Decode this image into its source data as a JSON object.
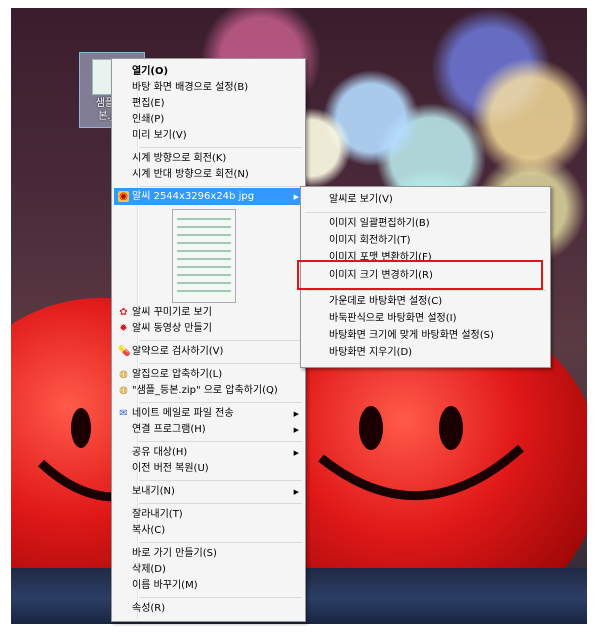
{
  "desktop": {
    "icon_label": "샘플_등본.jpg"
  },
  "context_menu": {
    "items": [
      {
        "label": "열기(O)",
        "bold": true
      },
      {
        "label": "바탕 화면 배경으로 설정(B)"
      },
      {
        "label": "편집(E)"
      },
      {
        "label": "인쇄(P)"
      },
      {
        "label": "미리 보기(V)"
      },
      {
        "label": "시계 방향으로 회전(K)"
      },
      {
        "label": "시계 반대 방향으로 회전(N)"
      },
      {
        "label": "알씨 2544x3296x24b jpg",
        "highlighted": true,
        "submenu": true
      },
      {
        "label": "알씨 꾸미기로 보기"
      },
      {
        "label": "알씨 동영상 만들기"
      },
      {
        "label": "알약으로 검사하기(V)"
      },
      {
        "label": "알집으로 압축하기(L)"
      },
      {
        "label": "\"샘플_등본.zip\" 으로 압축하기(Q)"
      },
      {
        "label": "네이트 메일로 파일 전송",
        "submenu": true
      },
      {
        "label": "연결 프로그램(H)",
        "submenu": true
      },
      {
        "label": "공유 대상(H)",
        "submenu": true
      },
      {
        "label": "이전 버전 복원(U)"
      },
      {
        "label": "보내기(N)",
        "submenu": true
      },
      {
        "label": "잘라내기(T)"
      },
      {
        "label": "복사(C)"
      },
      {
        "label": "바로 가기 만들기(S)"
      },
      {
        "label": "삭제(D)"
      },
      {
        "label": "이름 바꾸기(M)"
      },
      {
        "label": "속성(R)"
      }
    ]
  },
  "submenu": {
    "items": [
      {
        "label": "알씨로 보기(V)"
      },
      {
        "label": "이미지 일괄편집하기(B)"
      },
      {
        "label": "이미지 회전하기(T)"
      },
      {
        "label": "이미지 포맷 변환하기(F)"
      },
      {
        "label": "이미지 크기 변경하기(R)",
        "highlighted": true
      },
      {
        "label": "가운데로 바탕화면 설정(C)"
      },
      {
        "label": "바둑판식으로 바탕화면 설정(I)"
      },
      {
        "label": "바탕화면 크기에 맞게 바탕화면 설정(S)"
      },
      {
        "label": "바탕화면 지우기(D)"
      }
    ]
  },
  "colors": {
    "highlight": "#3399ff",
    "annotation_box": "#e0141c"
  }
}
